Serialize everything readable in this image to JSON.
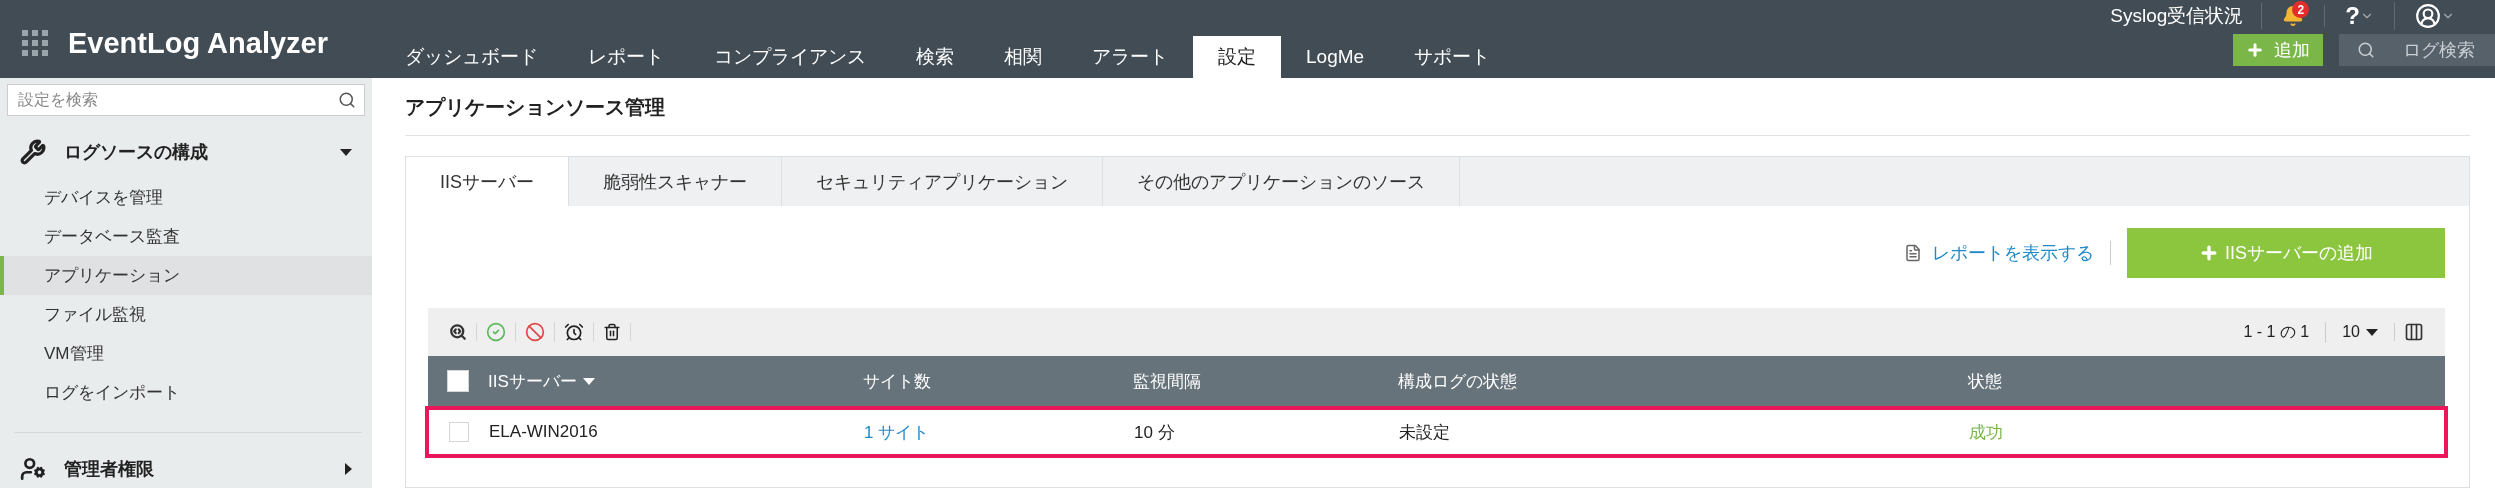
{
  "header": {
    "logo": "EventLog Analyzer",
    "status_link": "Syslog受信状況",
    "notification_count": "2",
    "help_label": "?",
    "add_button": "追加",
    "search_button": "ログ検索"
  },
  "nav_tabs": [
    {
      "label": "ダッシュボード",
      "selected": false
    },
    {
      "label": "レポート",
      "selected": false
    },
    {
      "label": "コンプライアンス",
      "selected": false
    },
    {
      "label": "検索",
      "selected": false
    },
    {
      "label": "相関",
      "selected": false
    },
    {
      "label": "アラート",
      "selected": false
    },
    {
      "label": "設定",
      "selected": true
    },
    {
      "label": "LogMe",
      "selected": false
    },
    {
      "label": "サポート",
      "selected": false
    }
  ],
  "sidebar": {
    "search_placeholder": "設定を検索",
    "sections": [
      {
        "title": "ログソースの構成",
        "kind": "tools",
        "expanded": true,
        "items": [
          {
            "label": "デバイスを管理",
            "selected": false
          },
          {
            "label": "データベース監査",
            "selected": false
          },
          {
            "label": "アプリケーション",
            "selected": true
          },
          {
            "label": "ファイル監視",
            "selected": false
          },
          {
            "label": "VM管理",
            "selected": false
          },
          {
            "label": "ログをインポート",
            "selected": false
          }
        ]
      },
      {
        "title": "管理者権限",
        "kind": "admin",
        "expanded": false
      }
    ]
  },
  "page_title": "アプリケーションソース管理",
  "tabs": [
    {
      "label": "IISサーバー",
      "selected": true
    },
    {
      "label": "脆弱性スキャナー",
      "selected": false
    },
    {
      "label": "セキュリティアプリケーション",
      "selected": false
    },
    {
      "label": "その他のアプリケーションのソース",
      "selected": false
    }
  ],
  "report_link": "レポートを表示する",
  "add_server_button": "IISサーバーの追加",
  "pagination": "1 - 1 の 1",
  "page_size": "10",
  "table": {
    "all_checked": false,
    "columns": [
      {
        "label": "IISサーバー",
        "sorted": true
      },
      {
        "label": "サイト数",
        "sorted": false
      },
      {
        "label": "監視間隔",
        "sorted": false
      },
      {
        "label": "構成ログの状態",
        "sorted": false
      },
      {
        "label": "状態",
        "sorted": false
      }
    ],
    "rows": [
      {
        "checked": false,
        "highlighted": true,
        "cells": [
          {
            "text": "ELA-WIN2016",
            "kind": "text"
          },
          {
            "text": "1 サイト",
            "kind": "link"
          },
          {
            "text": "10 分",
            "kind": "text"
          },
          {
            "text": "未設定",
            "kind": "text"
          },
          {
            "text": "成功",
            "kind": "status"
          }
        ]
      }
    ]
  }
}
